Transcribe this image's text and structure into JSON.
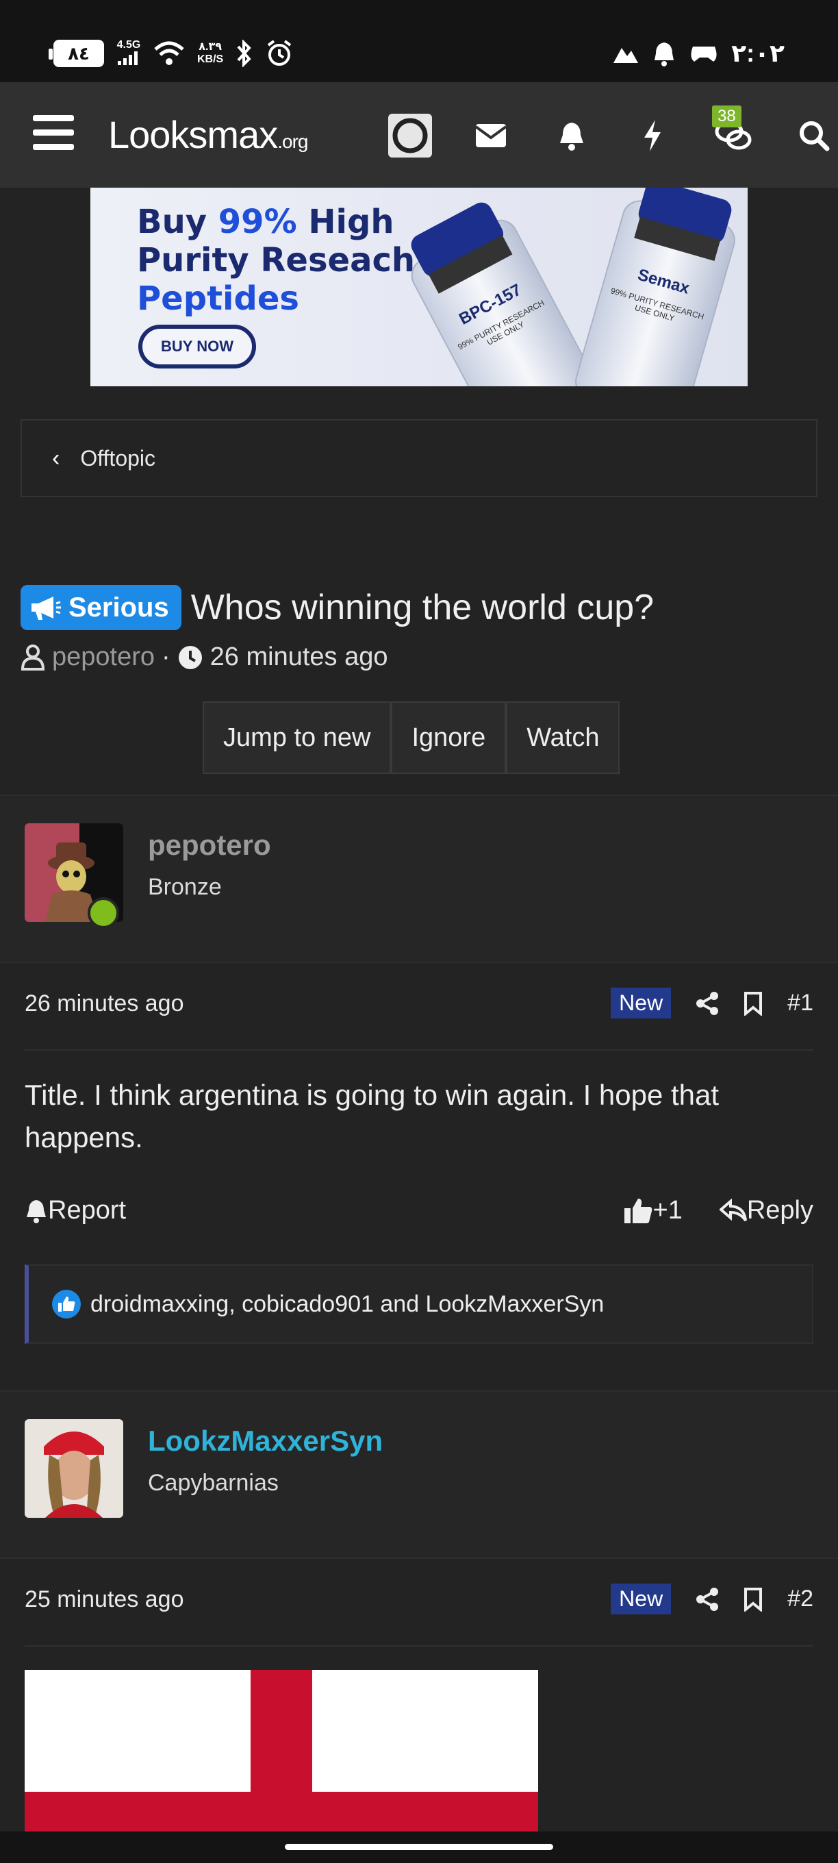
{
  "status_bar": {
    "battery": "٨٤",
    "network": "4.5G",
    "speed_value": "٨.٣٩",
    "speed_unit": "KB/S",
    "time": "٢:٠٢"
  },
  "nav": {
    "logo": "Looksmax",
    "logo_suffix": ".org",
    "chat_count": "38"
  },
  "ad": {
    "line1_a": "Buy ",
    "line1_b": "99%",
    "line1_c": " High",
    "line2": "Purity Reseach",
    "line3": "Peptides",
    "button": "BUY NOW",
    "vial1": "BPC-157",
    "vial2": "Semax",
    "vial_sub": "99% PURITY RESEARCH USE ONLY"
  },
  "breadcrumb": {
    "label": "Offtopic"
  },
  "thread": {
    "prefix": "Serious",
    "title": "Whos winning the world cup?",
    "author": "pepotero",
    "time": "26 minutes ago",
    "actions": [
      "Jump to new",
      "Ignore",
      "Watch"
    ]
  },
  "posts": [
    {
      "username": "pepotero",
      "rank": "Bronze",
      "time": "26 minutes ago",
      "badge": "New",
      "number": "#1",
      "text": "Title. I think argentina is going to win again. I hope that happens.",
      "report": "Report",
      "reaction": "+1",
      "reply": "Reply",
      "likes": "droidmaxxing, cobicado901 and LookzMaxxerSyn",
      "username_color": "#9a9a9a"
    },
    {
      "username": "LookzMaxxerSyn",
      "rank": "Capybarnias",
      "time": "25 minutes ago",
      "badge": "New",
      "number": "#2",
      "username_color": "#2fb3d9"
    }
  ]
}
